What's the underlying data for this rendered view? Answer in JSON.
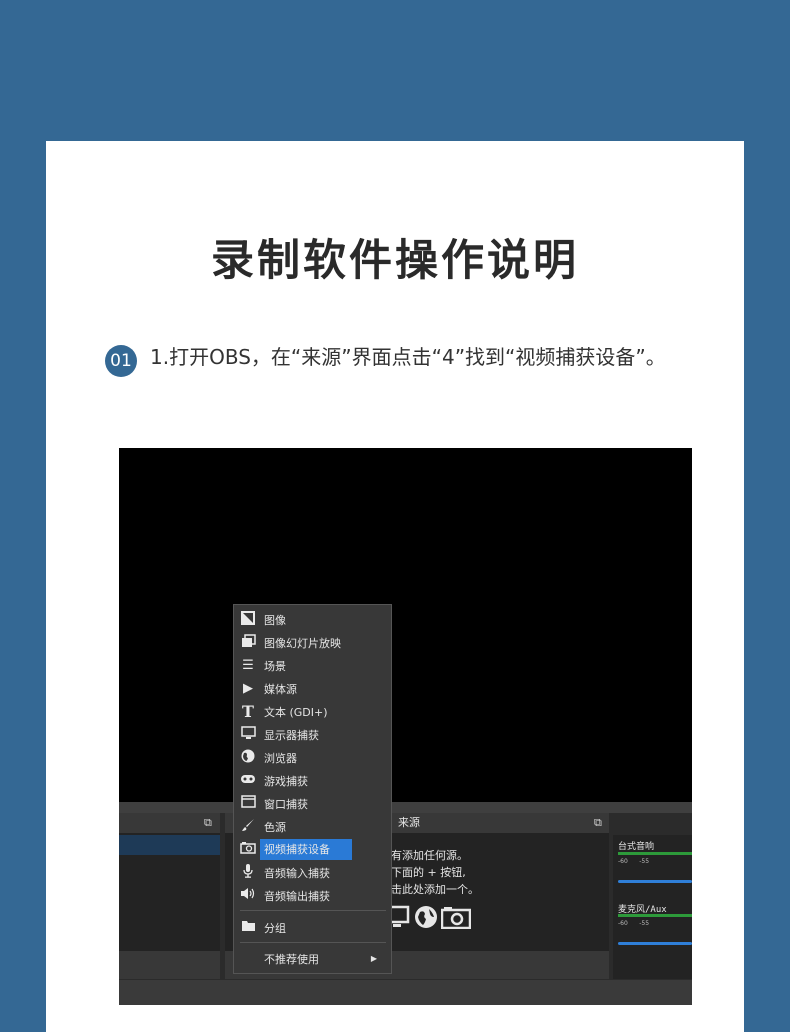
{
  "page": {
    "title": "录制软件操作说明",
    "step": {
      "number": "01",
      "text": "1.打开OBS，在“来源”界面点击“4”找到“视频捕获设备”。"
    }
  },
  "screenshot": {
    "sources_panel_title": "来源",
    "sources_hint": "有添加任何源。\n下面的 + 按钮,\n击此处添加一个。",
    "menu": [
      {
        "icon": "image-icon",
        "label": "图像"
      },
      {
        "icon": "slideshow-icon",
        "label": "图像幻灯片放映"
      },
      {
        "icon": "scene-list-icon",
        "label": "场景"
      },
      {
        "icon": "play-icon",
        "label": "媒体源"
      },
      {
        "icon": "text-icon",
        "label": "文本 (GDI+)"
      },
      {
        "icon": "monitor-icon",
        "label": "显示器捕获"
      },
      {
        "icon": "globe-icon",
        "label": "浏览器"
      },
      {
        "icon": "gamepad-icon",
        "label": "游戏捕获"
      },
      {
        "icon": "window-icon",
        "label": "窗口捕获"
      },
      {
        "icon": "brush-icon",
        "label": "色源"
      },
      {
        "icon": "camera-icon",
        "label": "视频捕获设备",
        "selected": true
      },
      {
        "icon": "microphone-icon",
        "label": "音频输入捕获"
      },
      {
        "icon": "speaker-icon",
        "label": "音频输出捕获"
      },
      {
        "icon": "folder-icon",
        "label": "分组"
      },
      {
        "icon": "",
        "label": "不推荐使用",
        "submenu": true
      }
    ],
    "mixer": [
      {
        "label": "台式音响",
        "ticks": "-60      -55"
      },
      {
        "label": "麦克风/Aux",
        "ticks": "-60      -55"
      }
    ]
  },
  "colors": {
    "background": "#346894",
    "accent": "#346894",
    "menu_highlight": "#2a7ad6"
  }
}
